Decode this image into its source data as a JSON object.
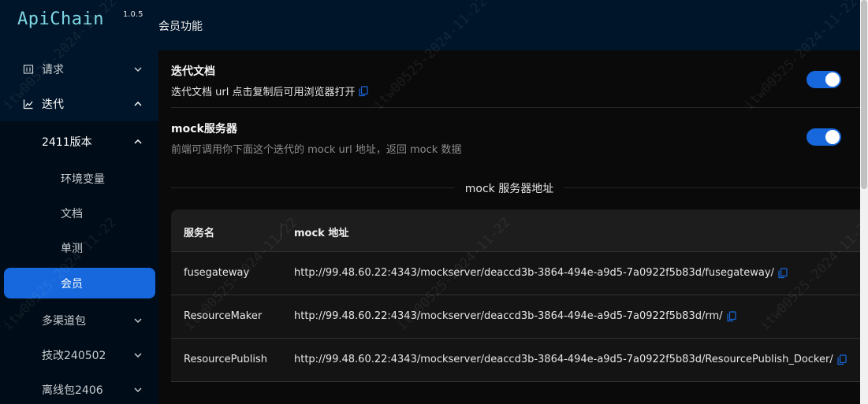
{
  "app": {
    "logo": "ApiChain",
    "version": "1.0.5"
  },
  "header": {
    "title": "会员功能"
  },
  "sidebar": {
    "items": [
      {
        "label": "请求",
        "icon": "table-icon",
        "expanded": false
      },
      {
        "label": "迭代",
        "icon": "line-chart-icon",
        "expanded": true
      },
      {
        "label": "2411版本",
        "expanded": true
      },
      {
        "label": "环境变量"
      },
      {
        "label": "文档"
      },
      {
        "label": "单测"
      },
      {
        "label": "会员",
        "selected": true
      },
      {
        "label": "多渠道包",
        "expanded": false
      },
      {
        "label": "技改240502",
        "expanded": false
      },
      {
        "label": "离线包2406",
        "expanded": false
      }
    ]
  },
  "settings": {
    "iteration_doc": {
      "title": "迭代文档",
      "description": "迭代文档 url 点击复制后可用浏览器打开",
      "enabled": true
    },
    "mock_server": {
      "title": "mock服务器",
      "description": "前端可调用你下面这个迭代的 mock url 地址，返回 mock 数据",
      "enabled": true
    }
  },
  "section_title": "mock 服务器地址",
  "table": {
    "columns": [
      "服务名",
      "mock 地址"
    ],
    "rows": [
      {
        "name": "fusegateway",
        "url": "http://99.48.60.22:4343/mockserver/deaccd3b-3864-494e-a9d5-7a0922f5b83d/fusegateway/"
      },
      {
        "name": "ResourceMaker",
        "url": "http://99.48.60.22:4343/mockserver/deaccd3b-3864-494e-a9d5-7a0922f5b83d/rm/"
      },
      {
        "name": "ResourcePublish",
        "url": "http://99.48.60.22:4343/mockserver/deaccd3b-3864-494e-a9d5-7a0922f5b83d/ResourcePublish_Docker/"
      }
    ]
  },
  "watermark": "itw00525-2024-11-22",
  "colors": {
    "sidebar_bg": "#001529",
    "submenu_bg": "#000c17",
    "accent": "#1668dc",
    "logo": "#7fd8e6"
  }
}
